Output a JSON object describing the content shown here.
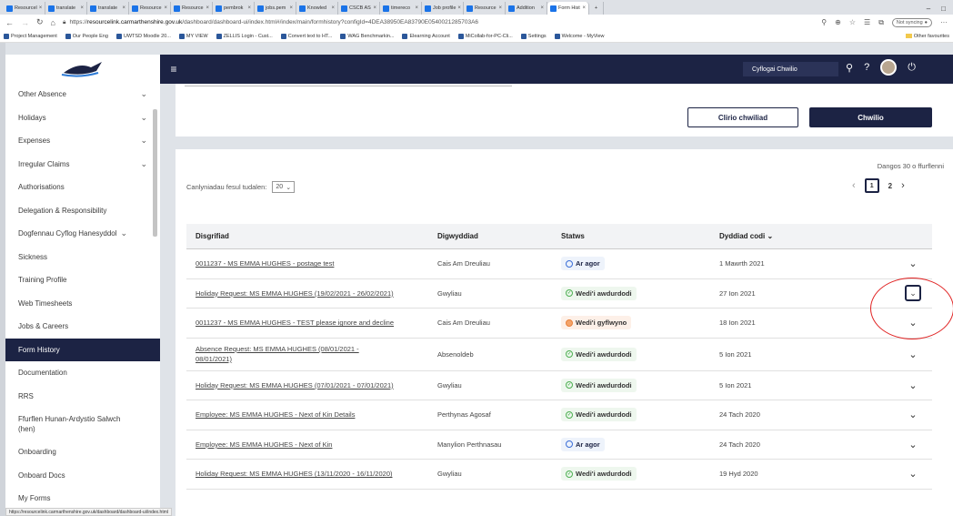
{
  "browser": {
    "tabs": [
      "Resourcel",
      "translate",
      "translate",
      "Resource",
      "Resource",
      "pembrok",
      "jobs.pem",
      "Knowled",
      "CSCB AS",
      "timereco",
      "Job profile",
      "Resource",
      "Addition",
      "Form Hist"
    ],
    "url_scheme": "https://",
    "url_host": "resourcelink.carmarthenshire.gov.uk",
    "url_path": "/dashboard/dashboard-ui/index.html#/index/main/formhistory?configId=4DEA38950EA83790E0540021285703A6",
    "sync_label": "Not syncing",
    "bookmarks": [
      "Project Management",
      "Our People Eng",
      "UWTSD Moodle 20...",
      "MY VIEW",
      "ZELLIS Login - Cust...",
      "Convert text to HT...",
      "WAG Benchmarkin...",
      "Elearning Account",
      "MiCollab-for-PC-Cli...",
      "Settings",
      "Welcome - MyView"
    ],
    "other_favourites": "Other favourites",
    "status_url": "https://resourcelink.carmarthenshire.gov.uk/dashboard/dashboard-ui/index.html"
  },
  "sidebar": {
    "items": [
      {
        "label": "Other Absence",
        "chevron": true
      },
      {
        "label": "Holidays",
        "chevron": true
      },
      {
        "label": "Expenses",
        "chevron": true
      },
      {
        "label": "Irregular Claims",
        "chevron": true
      },
      {
        "label": "Authorisations",
        "chevron": false
      },
      {
        "label": "Delegation & Responsibility",
        "chevron": false
      },
      {
        "label": "Dogfennau Cyflog Hanesyddol",
        "chevron": true
      },
      {
        "label": "Sickness",
        "chevron": false
      },
      {
        "label": "Training Profile",
        "chevron": false
      },
      {
        "label": "Web Timesheets",
        "chevron": false
      },
      {
        "label": "Jobs & Careers",
        "chevron": false
      },
      {
        "label": "Form History",
        "chevron": false,
        "active": true
      },
      {
        "label": "Documentation",
        "chevron": false
      },
      {
        "label": "RRS",
        "chevron": false
      },
      {
        "label": "Ffurflen Hunan-Ardystio Salwch (hen)",
        "chevron": false
      },
      {
        "label": "Onboarding",
        "chevron": false
      },
      {
        "label": "Onboard Docs",
        "chevron": false
      },
      {
        "label": "My Forms",
        "chevron": false
      }
    ]
  },
  "header": {
    "search_placeholder": "Cyflogai Chwilio",
    "help_icon": "?",
    "menu_icon": "≡"
  },
  "filter": {
    "clear_label": "Clirio chwiliad",
    "search_label": "Chwilio"
  },
  "table": {
    "per_page_label": "Canlyniadau fesul tudalen:",
    "per_page_value": "20",
    "showing": "Dangos 30 o ffurflenni",
    "pages": [
      "1",
      "2"
    ],
    "headers": [
      "Disgrifiad",
      "Digwyddiad",
      "Statws",
      "Dyddiad codi"
    ],
    "rows": [
      {
        "desc": "0011237 - MS EMMA HUGHES - postage test",
        "event": "Cais Am Dreuliau",
        "status": "Ar agor",
        "status_type": "open",
        "date": "1 Mawrth 2021"
      },
      {
        "desc": "Holiday Request: MS EMMA HUGHES (19/02/2021 - 26/02/2021)",
        "event": "Gwyliau",
        "status": "Wedi'i awdurdodi",
        "status_type": "ok",
        "date": "27 Ion 2021",
        "boxed": true
      },
      {
        "desc": "0011237 - MS EMMA HUGHES - TEST please ignore and decline",
        "event": "Cais Am Dreuliau",
        "status": "Wedi'i gyflwyno",
        "status_type": "sub",
        "date": "18 Ion 2021"
      },
      {
        "desc": "Absence Request: MS EMMA HUGHES (08/01/2021 - 08/01/2021)",
        "event": "Absenoldeb",
        "status": "Wedi'i awdurdodi",
        "status_type": "ok",
        "date": "5 Ion 2021"
      },
      {
        "desc": "Holiday Request: MS EMMA HUGHES (07/01/2021 - 07/01/2021)",
        "event": "Gwyliau",
        "status": "Wedi'i awdurdodi",
        "status_type": "ok",
        "date": "5 Ion 2021"
      },
      {
        "desc": "Employee: MS EMMA HUGHES - Next of Kin Details",
        "event": "Perthynas Agosaf",
        "status": "Wedi'i awdurdodi",
        "status_type": "ok",
        "date": "24 Tach 2020"
      },
      {
        "desc": "Employee: MS EMMA HUGHES - Next of Kin",
        "event": "Manylion Perthnasau",
        "status": "Ar agor",
        "status_type": "open",
        "date": "24 Tach 2020"
      },
      {
        "desc": "Holiday Request: MS EMMA HUGHES (13/11/2020 - 16/11/2020)",
        "event": "Gwyliau",
        "status": "Wedi'i awdurdodi",
        "status_type": "ok",
        "date": "19 Hyd 2020"
      }
    ]
  }
}
